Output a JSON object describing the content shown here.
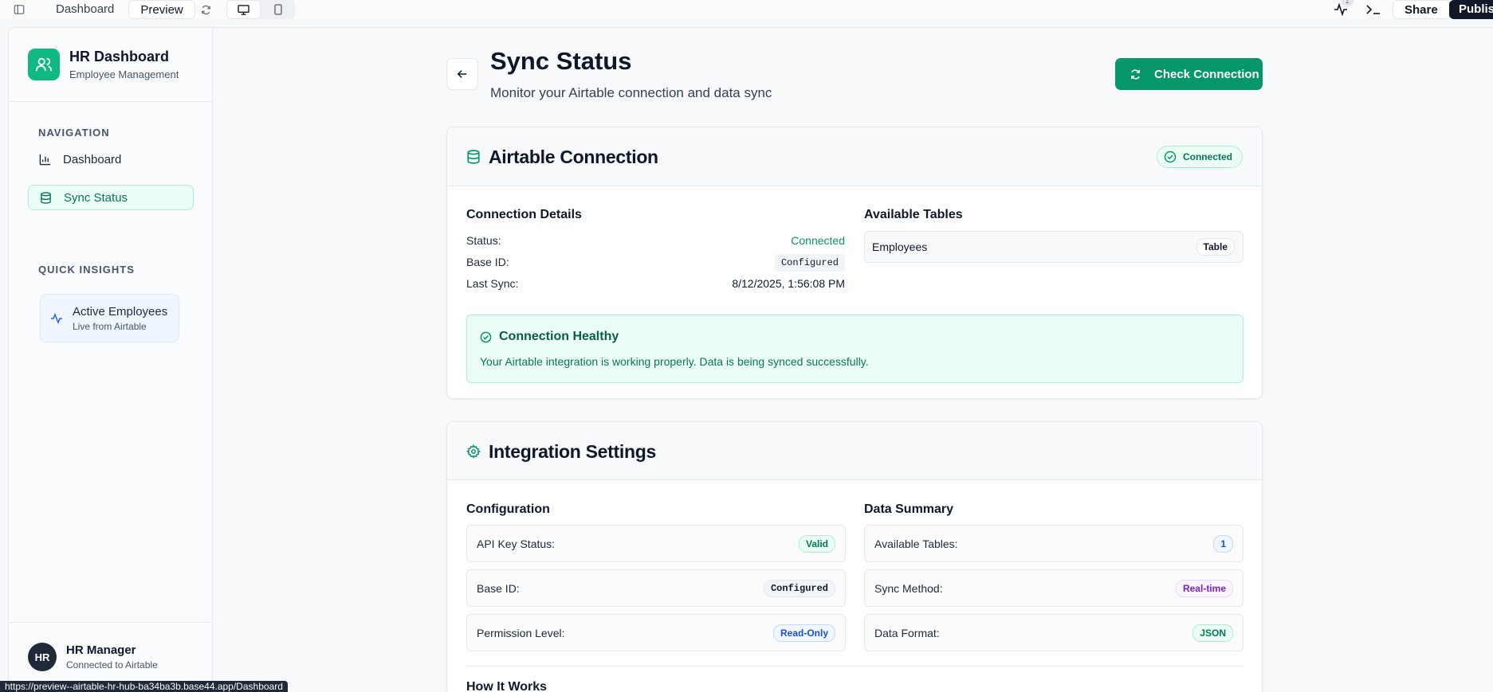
{
  "toolbar": {
    "tabs": [
      "Dashboard",
      "Preview"
    ],
    "notif_count": "1",
    "share_label": "Share",
    "publish_label": "Publish"
  },
  "sidebar": {
    "brand_title": "HR Dashboard",
    "brand_sub": "Employee Management",
    "nav_section": "NAVIGATION",
    "nav_items": [
      {
        "label": "Dashboard",
        "icon": "bar-chart-icon"
      },
      {
        "label": "Sync Status",
        "icon": "database-icon"
      }
    ],
    "insights_section": "QUICK INSIGHTS",
    "insight": {
      "title": "Active Employees",
      "sub": "Live from Airtable"
    },
    "user": {
      "initials": "HR",
      "name": "HR Manager",
      "sub": "Connected to Airtable"
    }
  },
  "header": {
    "title": "Sync Status",
    "subtitle": "Monitor your Airtable connection and data sync",
    "check_button": "Check Connection"
  },
  "connection_card": {
    "title": "Airtable Connection",
    "badge": "Connected",
    "details_title": "Connection Details",
    "status_label": "Status:",
    "status_value": "Connected",
    "base_label": "Base ID:",
    "base_value": "Configured",
    "sync_label": "Last Sync:",
    "sync_value": "8/12/2025, 1:56:08 PM",
    "tables_title": "Available Tables",
    "tables": [
      {
        "name": "Employees",
        "tag": "Table"
      }
    ],
    "health_title": "Connection Healthy",
    "health_msg": "Your Airtable integration is working properly. Data is being synced successfully."
  },
  "settings_card": {
    "title": "Integration Settings",
    "config_title": "Configuration",
    "config": [
      {
        "label": "API Key Status:",
        "value": "Valid",
        "style": "green"
      },
      {
        "label": "Base ID:",
        "value": "Configured",
        "style": "mono"
      },
      {
        "label": "Permission Level:",
        "value": "Read-Only",
        "style": "blue"
      }
    ],
    "summary_title": "Data Summary",
    "summary": [
      {
        "label": "Available Tables:",
        "value": "1",
        "style": "blue"
      },
      {
        "label": "Sync Method:",
        "value": "Real-time",
        "style": "purple"
      },
      {
        "label": "Data Format:",
        "value": "JSON",
        "style": "green"
      }
    ],
    "next_heading": "How It Works"
  },
  "status_url": "https://preview--airtable-hr-hub-ba34ba3b.base44.app/Dashboard",
  "colors": {
    "accent": "#059669",
    "accent_light": "#ecfdf5",
    "dark": "#111827"
  }
}
